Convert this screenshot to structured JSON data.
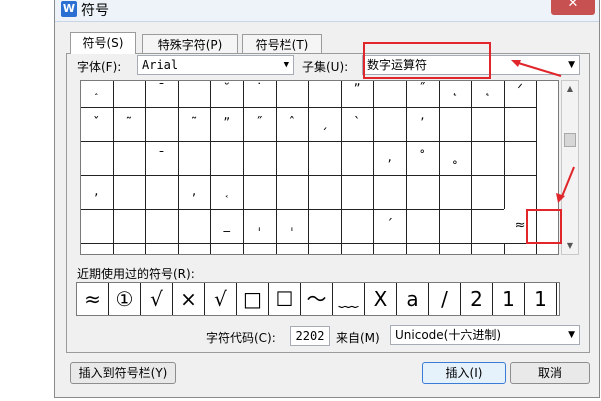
{
  "dialog": {
    "app_icon": "W",
    "title": "符号",
    "close_label": "✕"
  },
  "tabs": [
    {
      "label": "符号(S)",
      "active": true
    },
    {
      "label": "特殊字符(P)",
      "active": false
    },
    {
      "label": "符号栏(T)",
      "active": false
    }
  ],
  "font": {
    "label": "字体(F):",
    "value": "Arial"
  },
  "subset": {
    "label": "子集(U):",
    "value": "数字运算符"
  },
  "symbol_grid": {
    "rows": [
      [
        "ˆ",
        "",
        "¯",
        "",
        "˘",
        "˙",
        "˚",
        "",
        "˜",
        "",
        "ˮ",
        "˛",
        "",
        "ˇ",
        "̣",
        "ᐢ",
        "",
        "˝",
        "″",
        "ᐟ"
      ],
      [
        "̑",
        "˟",
        "’",
        "-",
        "’",
        "",
        "",
        "",
        "",
        "",
        "",
        "",
        "",
        "",
        "",
        "",
        "",
        "",
        "",
        "",
        ""
      ],
      [
        "",
        "ˌ",
        "ˌ",
        "",
        "",
        "ˈ",
        "",
        "",
        "",
        "",
        "",
        "",
        "",
        "",
        "",
        "",
        "",
        "",
        "",
        ""
      ]
    ],
    "cells": [
      "˰",
      "",
      "¯",
      "",
      "˘",
      "˙",
      "",
      "",
      "ˮ",
      "",
      "˝",
      "˛",
      "˛",
      "ᐟ",
      "ˇ",
      "˜",
      "",
      "˜",
      "ˮ",
      "˝",
      "ˆ",
      "ˏ",
      "ˋ",
      "",
      "ʼ",
      "",
      "",
      "",
      "",
      "",
      "ˉ",
      "",
      "",
      "",
      "",
      "",
      "",
      ",",
      "˚",
      "˳",
      "",
      "",
      ",",
      "",
      "",
      ",",
      "˱",
      "",
      "",
      "",
      "",
      "",
      "",
      "",
      "",
      "",
      "",
      "",
      "",
      "",
      "_",
      "ˌ",
      "ˌ",
      "",
      "",
      "ˊ",
      "",
      "",
      "",
      "˘",
      "",
      "",
      "",
      "",
      "",
      "",
      "",
      "",
      "",
      "",
      "ˬ",
      "",
      "ˍ",
      "",
      "",
      "˳",
      "",
      "",
      "",
      "",
      "",
      "",
      "",
      "",
      "",
      "",
      "",
      "",
      "",
      ""
    ]
  },
  "recent": {
    "label": "近期使用过的符号(R):",
    "symbols": [
      "≈",
      "①",
      "√",
      "×",
      "√",
      "□",
      "☐",
      "〜",
      "﹏",
      "X",
      "a",
      "/",
      "2",
      "1",
      "1"
    ]
  },
  "char_code": {
    "label": "字符代码(C):",
    "value": "2202"
  },
  "from": {
    "label": "来自(M)",
    "value": "Unicode(十六进制)"
  },
  "buttons": {
    "insert_to_bar": "插入到符号栏(Y)",
    "insert": "插入(I)",
    "cancel": "取消"
  },
  "colors": {
    "highlight": "#e0262b",
    "titlebar": "#eef3fa",
    "close": "#c75050"
  }
}
